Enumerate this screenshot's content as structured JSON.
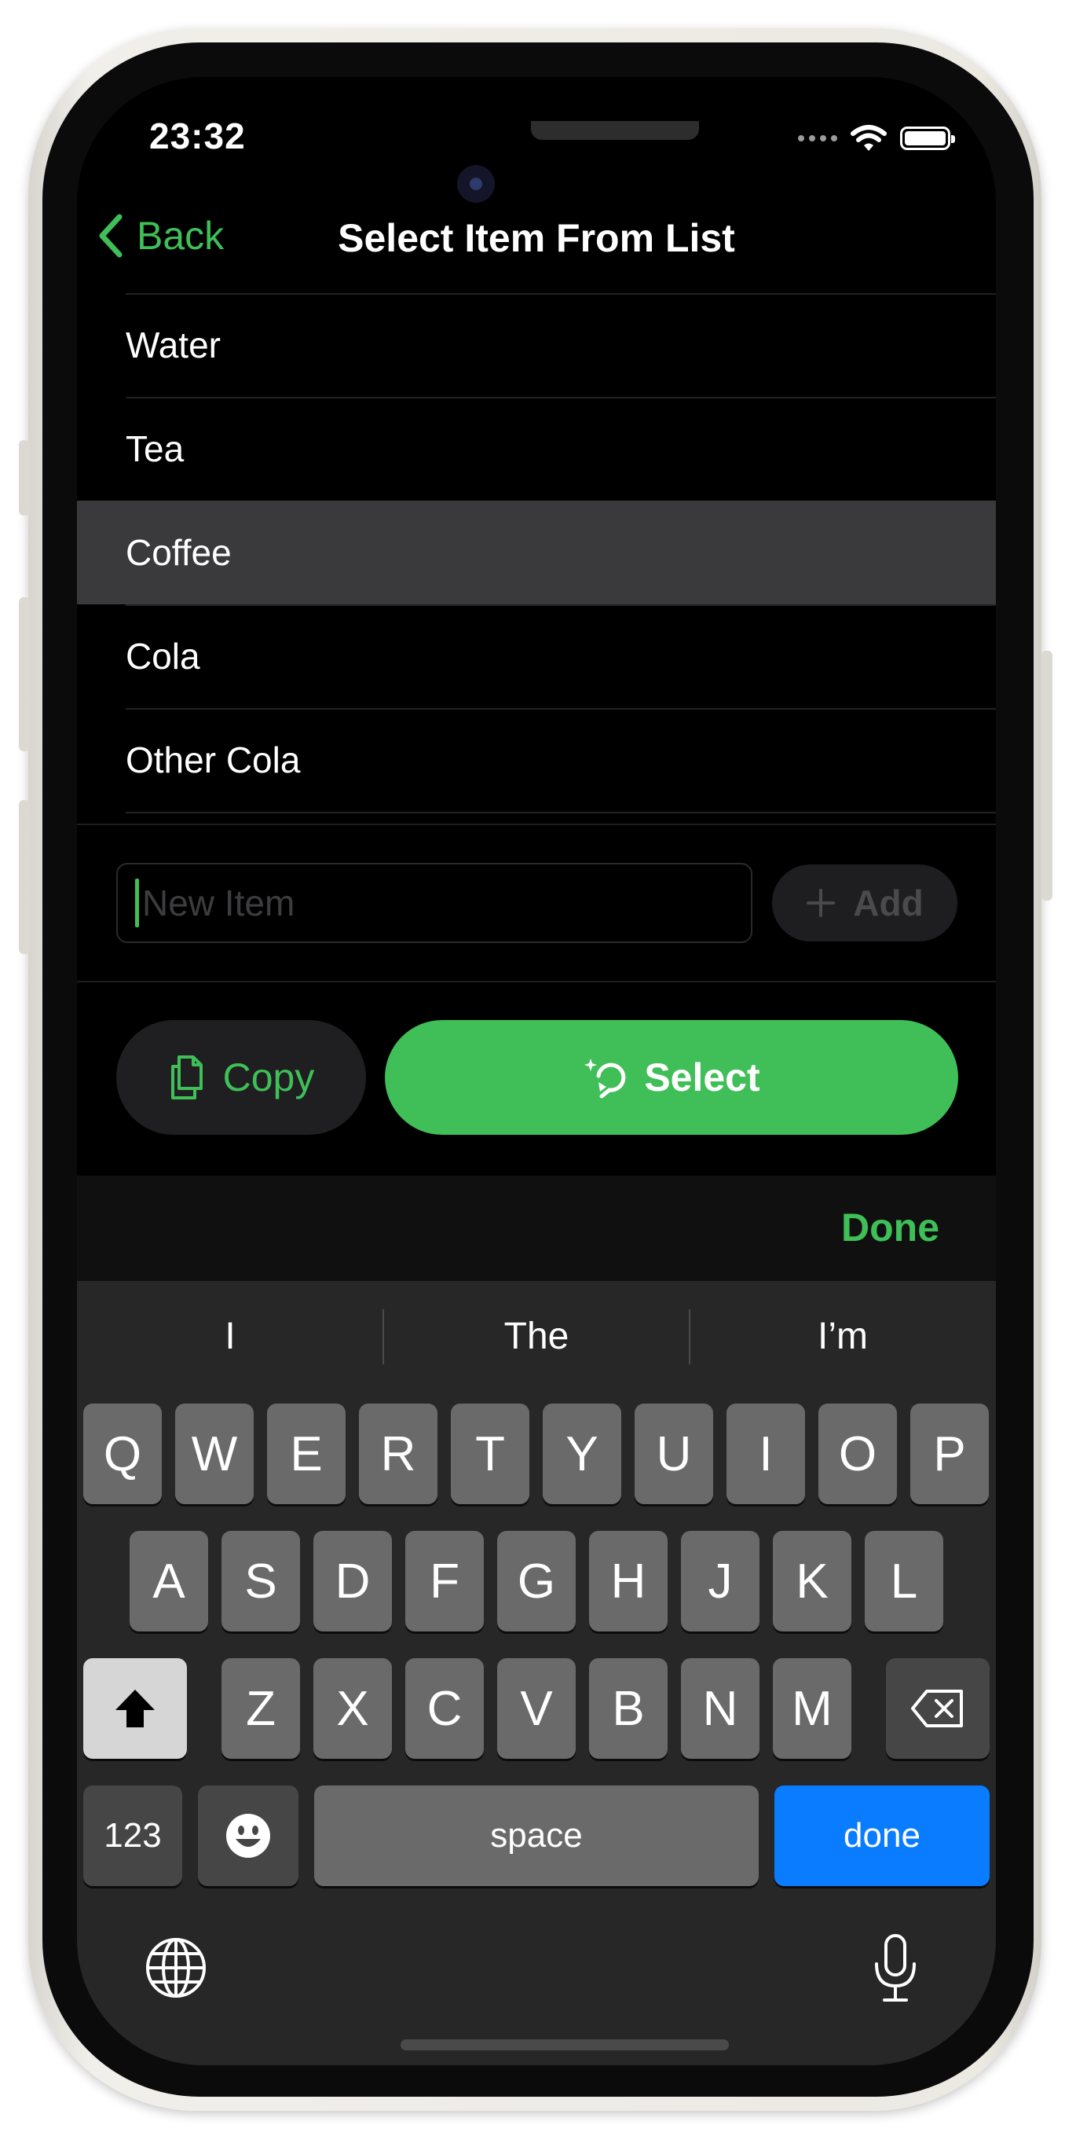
{
  "status": {
    "time": "23:32"
  },
  "nav": {
    "back_label": "Back",
    "title": "Select Item From List"
  },
  "list": {
    "items": [
      {
        "label": "Water",
        "selected": false
      },
      {
        "label": "Tea",
        "selected": false
      },
      {
        "label": "Coffee",
        "selected": true
      },
      {
        "label": "Cola",
        "selected": false
      },
      {
        "label": "Other Cola",
        "selected": false
      }
    ]
  },
  "new_item": {
    "placeholder": "New Item",
    "value": "",
    "add_label": "Add"
  },
  "actions": {
    "copy_label": "Copy",
    "select_label": "Select"
  },
  "keyboard": {
    "accessory_done": "Done",
    "suggestions": [
      "I",
      "The",
      "I’m"
    ],
    "row1": [
      "Q",
      "W",
      "E",
      "R",
      "T",
      "Y",
      "U",
      "I",
      "O",
      "P"
    ],
    "row2": [
      "A",
      "S",
      "D",
      "F",
      "G",
      "H",
      "J",
      "K",
      "L"
    ],
    "row3": [
      "Z",
      "X",
      "C",
      "V",
      "B",
      "N",
      "M"
    ],
    "numbers_label": "123",
    "space_label": "space",
    "return_label": "done"
  },
  "colors": {
    "accent": "#40bf58",
    "return_key": "#0a7cff",
    "selected_row": "#3a3a3c"
  },
  "icons": [
    "back-chevron-icon",
    "plus-icon",
    "copy-doc-icon",
    "select-sparkle-icon",
    "shift-arrow-icon",
    "backspace-icon",
    "emoji-icon",
    "globe-icon",
    "microphone-icon",
    "wifi-icon",
    "battery-icon"
  ]
}
